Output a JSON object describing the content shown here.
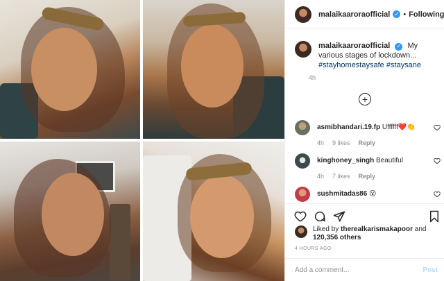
{
  "header": {
    "username": "malaikaaroraofficial",
    "separator": "•",
    "follow_label": "Following"
  },
  "caption": {
    "username": "malaikaaroraofficial",
    "text": "My various stages of lockdown...",
    "hashtags": [
      "#stayhomestaysafe",
      "#staysane"
    ],
    "time": "4h"
  },
  "load_more_icon": "plus-circle-icon",
  "comments": [
    {
      "username": "asmibhandari.19.fp",
      "text": "Uffffff❤️👏",
      "time": "4h",
      "likes": "9 likes",
      "reply": "Reply",
      "avatar_color": "#6b6f62"
    },
    {
      "username": "kinghoney_singh",
      "text": "Beautiful",
      "time": "4h",
      "likes": "7 likes",
      "reply": "Reply",
      "avatar_color": "#3a4a4f"
    },
    {
      "username": "sushmitadas86",
      "text": "😮",
      "time": "",
      "likes": "",
      "reply": "",
      "avatar_color": "#c43a4a"
    }
  ],
  "actions": {
    "like_icon": "heart-icon",
    "comment_icon": "comment-icon",
    "share_icon": "paper-plane-icon",
    "save_icon": "bookmark-icon"
  },
  "likes": {
    "prefix": "Liked by",
    "user": "therealkarismakapoor",
    "connector": "and",
    "others": "120,356 others"
  },
  "time_ago": "4 HOURS AGO",
  "add_comment": {
    "placeholder": "Add a comment...",
    "post_label": "Post"
  },
  "colors": {
    "accent_blue": "#3897f0",
    "hashtag": "#00376b",
    "post_disabled": "#b2dffc",
    "muted": "#8e8e8e"
  }
}
